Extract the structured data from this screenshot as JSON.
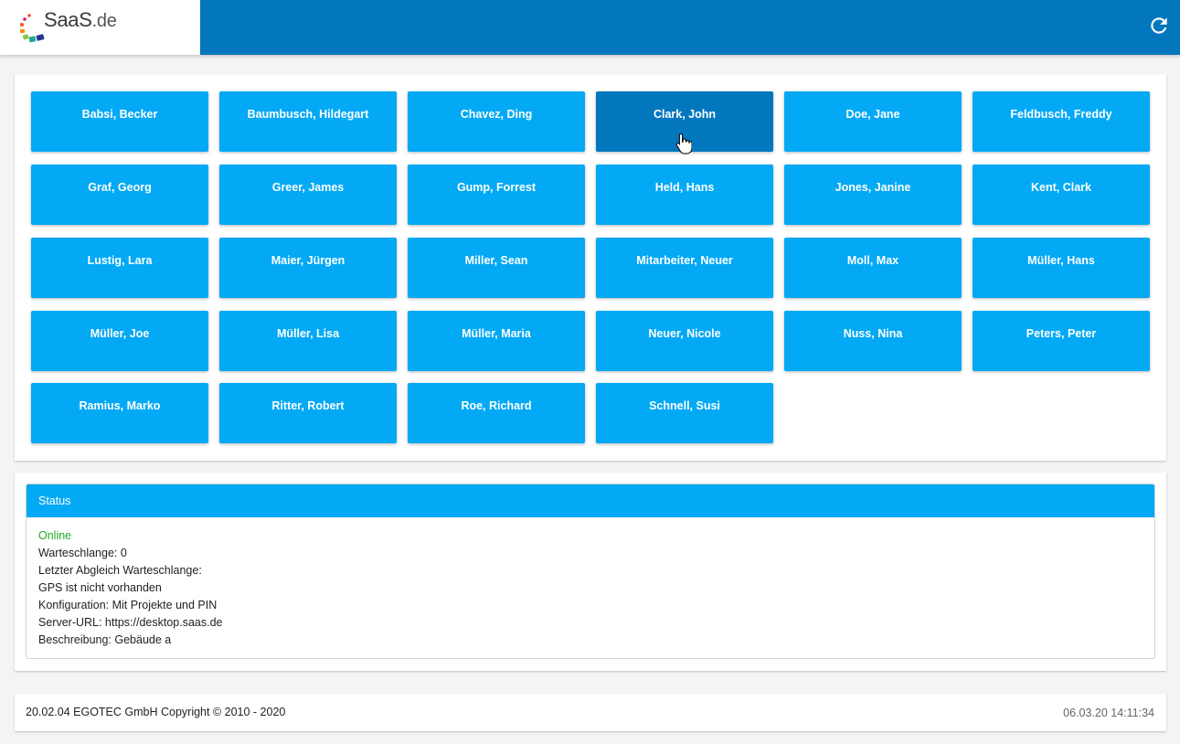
{
  "header": {
    "brand": "SaaS",
    "brand_tld": ".de",
    "refresh_icon": "refresh-icon",
    "bar_color": "#0277bd"
  },
  "employees": [
    {
      "name": "Babsi, Becker"
    },
    {
      "name": "Baumbusch, Hildegart"
    },
    {
      "name": "Chavez, Ding"
    },
    {
      "name": "Clark, John",
      "active": true
    },
    {
      "name": "Doe, Jane"
    },
    {
      "name": "Feldbusch, Freddy"
    },
    {
      "name": "Graf, Georg"
    },
    {
      "name": "Greer, James"
    },
    {
      "name": "Gump, Forrest"
    },
    {
      "name": "Held, Hans"
    },
    {
      "name": "Jones, Janine"
    },
    {
      "name": "Kent, Clark"
    },
    {
      "name": "Lustig, Lara"
    },
    {
      "name": "Maier, Jürgen"
    },
    {
      "name": "Miller, Sean"
    },
    {
      "name": "Mitarbeiter, Neuer"
    },
    {
      "name": "Moll, Max"
    },
    {
      "name": "Müller, Hans"
    },
    {
      "name": "Müller, Joe"
    },
    {
      "name": "Müller, Lisa"
    },
    {
      "name": "Müller, Maria"
    },
    {
      "name": "Neuer, Nicole"
    },
    {
      "name": "Nuss, Nina"
    },
    {
      "name": "Peters, Peter"
    },
    {
      "name": "Ramius, Marko"
    },
    {
      "name": "Ritter, Robert"
    },
    {
      "name": "Roe, Richard"
    },
    {
      "name": "Schnell, Susi"
    }
  ],
  "colors": {
    "button": "#03a9f4",
    "button_active": "#0277bd",
    "online": "#23a823"
  },
  "status": {
    "title": "Status",
    "online": "Online",
    "queue": "Warteschlange: 0",
    "last_sync": "Letzter Abgleich Warteschlange:",
    "gps": "GPS ist nicht vorhanden",
    "config": "Konfiguration: Mit Projekte und PIN",
    "server_url": "Server-URL: https://desktop.saas.de",
    "description": "Beschreibung: Gebäude a"
  },
  "footer": {
    "copyright": "20.02.04 EGOTEC GmbH Copyright © 2010 - 2020",
    "datetime": "06.03.20 14:11:34"
  }
}
